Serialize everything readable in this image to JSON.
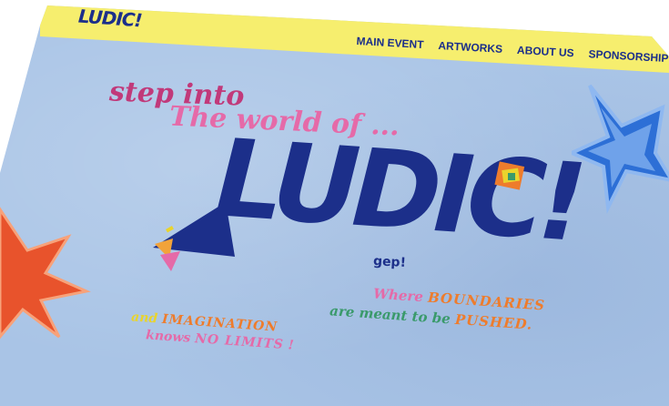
{
  "brand": {
    "logo_text": "LUDIC!"
  },
  "nav": {
    "items": [
      {
        "label": "MAIN EVENT"
      },
      {
        "label": "ARTWORKS"
      },
      {
        "label": "ABOUT US"
      },
      {
        "label": "SPONSORSHIP"
      }
    ]
  },
  "hero": {
    "line1": "step into",
    "line2": "The world of ...",
    "logo_text": "LUDIC!",
    "tag_small": "gep!",
    "tagline_right": {
      "part1": "Where ",
      "part1_emph": "BOUNDARIES",
      "part2": "are meant to be ",
      "part2_emph": "PUSHED."
    },
    "tagline_left": {
      "part1": "and ",
      "part1_emph": "IMAGINATION",
      "part2": "knows ",
      "part2_emph": "NO LIMITS",
      "part2_end": " !"
    }
  },
  "colors": {
    "background": "#a9c4e6",
    "nav": "#f6ee6e",
    "brand_blue": "#1c2f8a",
    "pink": "#e56aa8",
    "orange": "#ee7c2c",
    "green": "#3a9a6b",
    "yellow": "#e9d42d",
    "star_left": "#e8532c",
    "star_right": "#2d6fd6"
  }
}
